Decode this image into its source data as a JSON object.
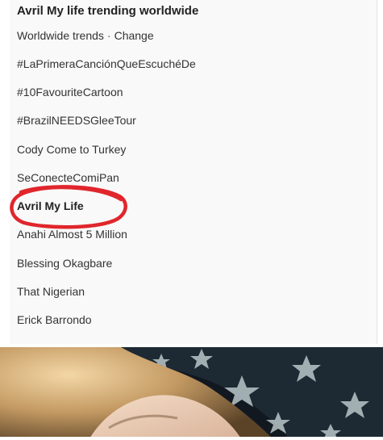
{
  "trends": {
    "title": "Avril My life trending worldwide",
    "location_label": "Worldwide trends",
    "separator": "·",
    "change_label": "Change",
    "items": [
      {
        "label": "#LaPrimeraCanciónQueEscuchéDe"
      },
      {
        "label": "#10FavouriteCartoon"
      },
      {
        "label": "#BrazilNEEDSGleeTour"
      },
      {
        "label": "Cody Come to Turkey"
      },
      {
        "label": "SeConecteComiPan"
      },
      {
        "label": "Avril My Life"
      },
      {
        "label": "Anahi Almost 5 Million"
      },
      {
        "label": "Blessing Okagbare"
      },
      {
        "label": "That Nigerian"
      },
      {
        "label": "Erick Barrondo"
      }
    ]
  },
  "colors": {
    "highlight_circle": "#e0262c",
    "text": "#333333",
    "panel_bg": "#f9f9f9"
  }
}
